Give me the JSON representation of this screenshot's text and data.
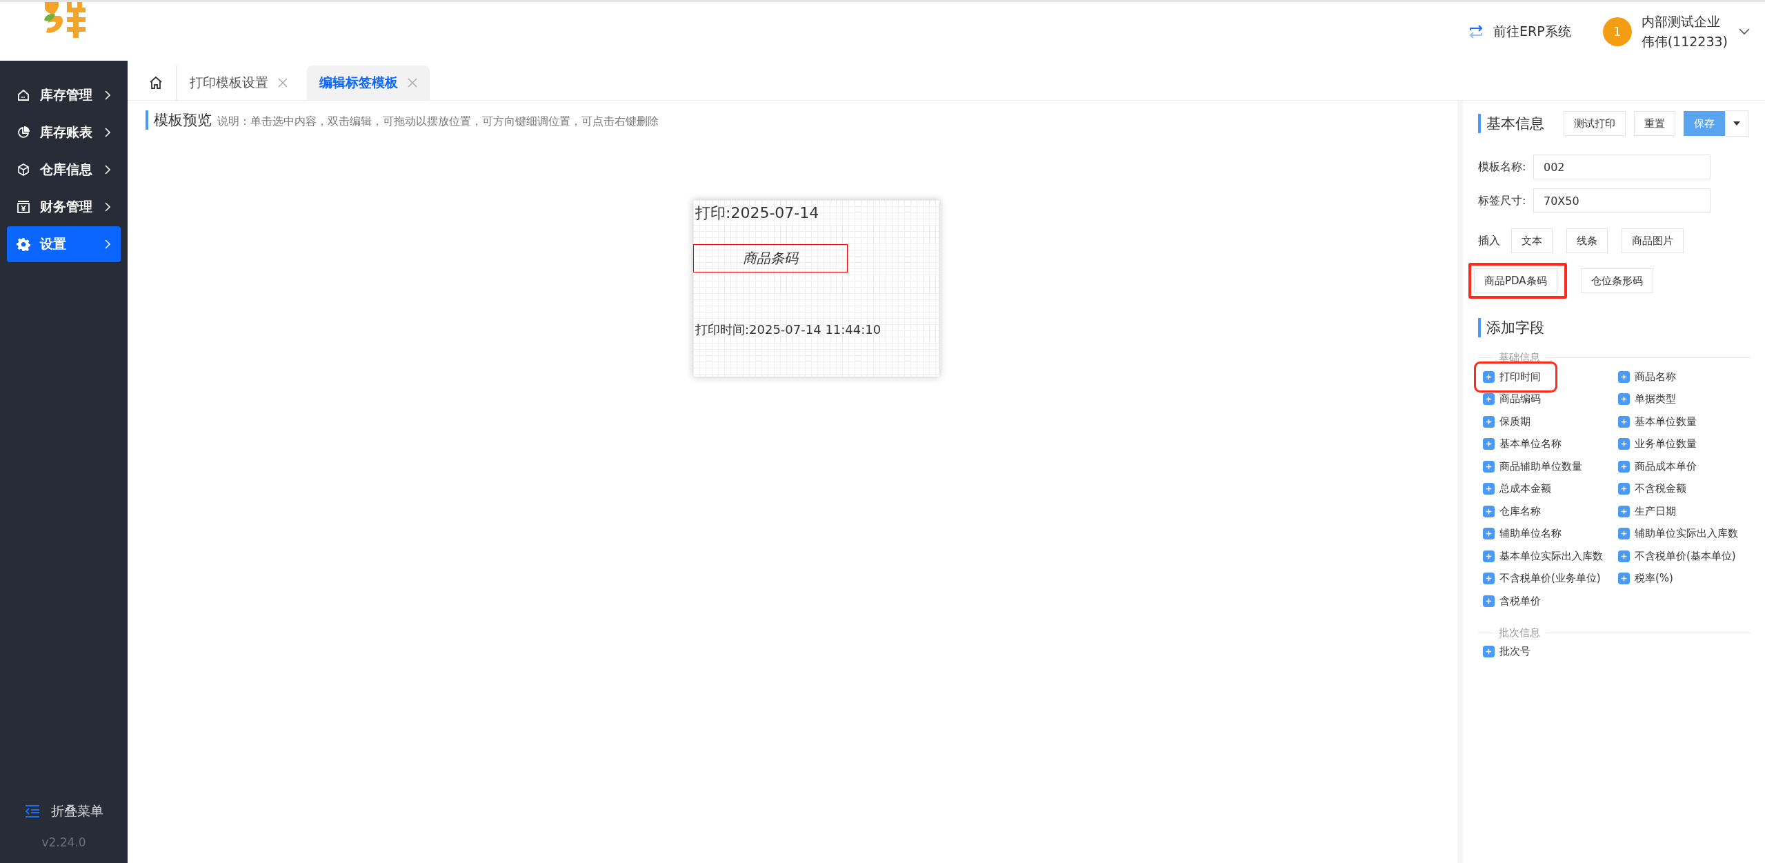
{
  "header": {
    "erp_link": "前往ERP系统",
    "notification_count": "1",
    "company": "内部测试企业",
    "user": "伟伟(112233)"
  },
  "sidebar": {
    "items": [
      {
        "label": "库存管理",
        "selected": false
      },
      {
        "label": "库存账表",
        "selected": false
      },
      {
        "label": "仓库信息",
        "selected": false
      },
      {
        "label": "财务管理",
        "selected": false
      },
      {
        "label": "设置",
        "selected": true
      }
    ],
    "collapse": "折叠菜单",
    "version": "v2.24.0"
  },
  "tabs": [
    {
      "label": "打印模板设置",
      "selected": false
    },
    {
      "label": "编辑标签模板",
      "selected": true
    }
  ],
  "preview": {
    "title": "模板预览",
    "hint": "说明：单击选中内容，双击编辑，可拖动以摆放位置，可方向键细调位置，可点击右键删除",
    "label_items": [
      {
        "kind": "text",
        "text": "打印:2025-07-14"
      },
      {
        "kind": "barcode",
        "text": "商品条码"
      },
      {
        "kind": "time",
        "text": "打印时间:2025-07-14 11:44:10"
      }
    ]
  },
  "panel": {
    "title": "基本信息",
    "buttons": [
      {
        "label": "测试打印",
        "kind": "plain"
      },
      {
        "label": "重置",
        "kind": "plain"
      },
      {
        "label": "保存",
        "kind": "primary"
      }
    ],
    "name_label": "模板名称:",
    "name_value": "002",
    "size_label": "标签尺寸:",
    "size_value": "70X50",
    "insert_label": "插入",
    "insert_buttons": [
      {
        "label": "文本",
        "highlighted": false
      },
      {
        "label": "线条",
        "highlighted": false
      },
      {
        "label": "商品图片",
        "highlighted": false
      },
      {
        "label": "商品PDA条码",
        "highlighted": true
      },
      {
        "label": "仓位条形码",
        "highlighted": false
      }
    ],
    "fields_title": "添加字段",
    "groups": [
      {
        "title": "基础信息",
        "fields": [
          {
            "label": "打印时间",
            "highlighted": true
          },
          {
            "label": "商品名称",
            "highlighted": false
          },
          {
            "label": "商品编码",
            "highlighted": false
          },
          {
            "label": "单据类型",
            "highlighted": false
          },
          {
            "label": "保质期",
            "highlighted": false
          },
          {
            "label": "基本单位数量",
            "highlighted": false
          },
          {
            "label": "基本单位名称",
            "highlighted": false
          },
          {
            "label": "业务单位数量",
            "highlighted": false
          },
          {
            "label": "商品辅助单位数量",
            "highlighted": false
          },
          {
            "label": "商品成本单价",
            "highlighted": false
          },
          {
            "label": "总成本金额",
            "highlighted": false
          },
          {
            "label": "不含税金额",
            "highlighted": false
          },
          {
            "label": "仓库名称",
            "highlighted": false
          },
          {
            "label": "生产日期",
            "highlighted": false
          },
          {
            "label": "辅助单位名称",
            "highlighted": false
          },
          {
            "label": "辅助单位实际出入库数",
            "highlighted": false
          },
          {
            "label": "基本单位实际出入库数",
            "highlighted": false
          },
          {
            "label": "不含税单价(基本单位)",
            "highlighted": false
          },
          {
            "label": "不含税单价(业务单位)",
            "highlighted": false
          },
          {
            "label": "税率(%)",
            "highlighted": false
          },
          {
            "label": "含税单价",
            "highlighted": false
          }
        ]
      },
      {
        "title": "批次信息",
        "fields": [
          {
            "label": "批次号",
            "highlighted": false
          }
        ]
      }
    ]
  }
}
